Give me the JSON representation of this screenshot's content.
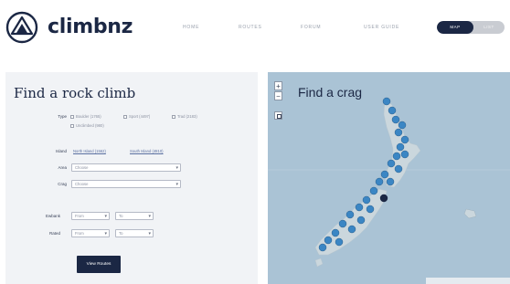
{
  "header": {
    "brand": "climbnz",
    "nav": [
      "HOME",
      "ROUTES",
      "FORUM",
      "USER GUIDE"
    ],
    "toggle": {
      "active": "MAP",
      "inactive": "LIST"
    }
  },
  "search_panel": {
    "title": "Find a rock climb",
    "type_label": "Type",
    "type_options": [
      "Boulder (1765)",
      "Sport (4497)",
      "Trad (2183)",
      "Unclimbed (980)"
    ],
    "island_label": "Island",
    "island_links": [
      "North Island (1562)",
      "South Island (4810)"
    ],
    "area_label": "Area",
    "area_value": "Choose",
    "crag_label": "Crag",
    "crag_value": "Choose",
    "ewbank_label": "Ewbank",
    "ewbank_from": "From",
    "ewbank_to": "To",
    "rated_label": "Rated",
    "rated_from": "From",
    "rated_to": "To",
    "submit_label": "View Routes"
  },
  "map": {
    "title": "Find a crag",
    "zoom_in": "+",
    "zoom_out": "−",
    "water_color": "#aac3d5",
    "land_color": "#cbd7dd",
    "marker_color": "#3b86c4"
  }
}
